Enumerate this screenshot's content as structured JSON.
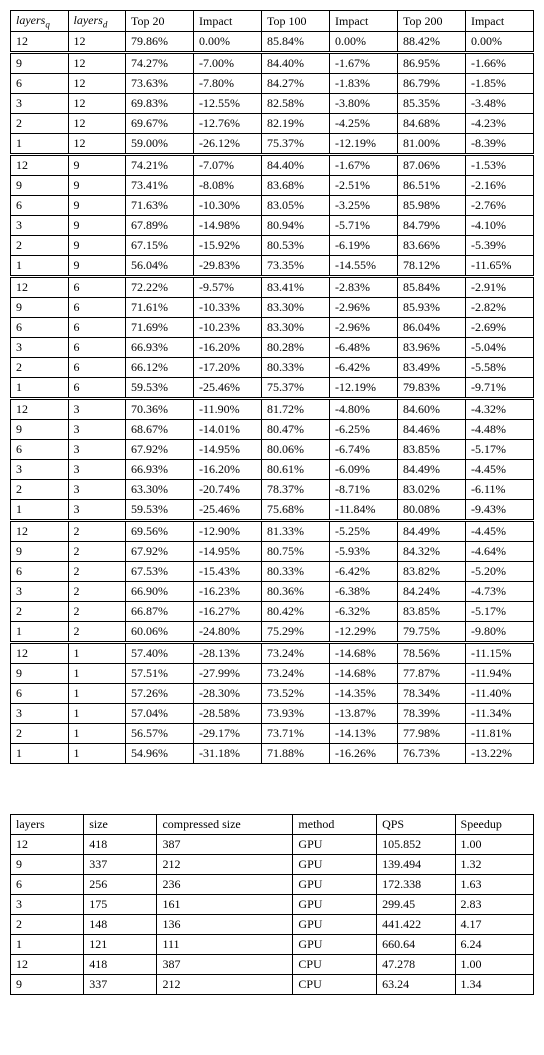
{
  "chart_data": [
    {
      "type": "table",
      "title": "",
      "columns": [
        "layers_q",
        "layers_d",
        "Top 20",
        "Impact",
        "Top 100",
        "Impact",
        "Top 200",
        "Impact"
      ],
      "groups": [
        [
          {
            "layers_q": "12",
            "layers_d": "12",
            "top20": "79.86%",
            "impact20": "0.00%",
            "top100": "85.84%",
            "impact100": "0.00%",
            "top200": "88.42%",
            "impact200": "0.00%"
          }
        ],
        [
          {
            "layers_q": "9",
            "layers_d": "12",
            "top20": "74.27%",
            "impact20": "-7.00%",
            "top100": "84.40%",
            "impact100": "-1.67%",
            "top200": "86.95%",
            "impact200": "-1.66%"
          },
          {
            "layers_q": "6",
            "layers_d": "12",
            "top20": "73.63%",
            "impact20": "-7.80%",
            "top100": "84.27%",
            "impact100": "-1.83%",
            "top200": "86.79%",
            "impact200": "-1.85%"
          },
          {
            "layers_q": "3",
            "layers_d": "12",
            "top20": "69.83%",
            "impact20": "-12.55%",
            "top100": "82.58%",
            "impact100": "-3.80%",
            "top200": "85.35%",
            "impact200": "-3.48%"
          },
          {
            "layers_q": "2",
            "layers_d": "12",
            "top20": "69.67%",
            "impact20": "-12.76%",
            "top100": "82.19%",
            "impact100": "-4.25%",
            "top200": "84.68%",
            "impact200": "-4.23%"
          },
          {
            "layers_q": "1",
            "layers_d": "12",
            "top20": "59.00%",
            "impact20": "-26.12%",
            "top100": "75.37%",
            "impact100": "-12.19%",
            "top200": "81.00%",
            "impact200": "-8.39%"
          }
        ],
        [
          {
            "layers_q": "12",
            "layers_d": "9",
            "top20": "74.21%",
            "impact20": "-7.07%",
            "top100": "84.40%",
            "impact100": "-1.67%",
            "top200": "87.06%",
            "impact200": "-1.53%"
          },
          {
            "layers_q": "9",
            "layers_d": "9",
            "top20": "73.41%",
            "impact20": "-8.08%",
            "top100": "83.68%",
            "impact100": "-2.51%",
            "top200": "86.51%",
            "impact200": "-2.16%"
          },
          {
            "layers_q": "6",
            "layers_d": "9",
            "top20": "71.63%",
            "impact20": "-10.30%",
            "top100": "83.05%",
            "impact100": "-3.25%",
            "top200": "85.98%",
            "impact200": "-2.76%"
          },
          {
            "layers_q": "3",
            "layers_d": "9",
            "top20": "67.89%",
            "impact20": "-14.98%",
            "top100": "80.94%",
            "impact100": "-5.71%",
            "top200": "84.79%",
            "impact200": "-4.10%"
          },
          {
            "layers_q": "2",
            "layers_d": "9",
            "top20": "67.15%",
            "impact20": "-15.92%",
            "top100": "80.53%",
            "impact100": "-6.19%",
            "top200": "83.66%",
            "impact200": "-5.39%"
          },
          {
            "layers_q": "1",
            "layers_d": "9",
            "top20": "56.04%",
            "impact20": "-29.83%",
            "top100": "73.35%",
            "impact100": "-14.55%",
            "top200": "78.12%",
            "impact200": "-11.65%"
          }
        ],
        [
          {
            "layers_q": "12",
            "layers_d": "6",
            "top20": "72.22%",
            "impact20": "-9.57%",
            "top100": "83.41%",
            "impact100": "-2.83%",
            "top200": "85.84%",
            "impact200": "-2.91%"
          },
          {
            "layers_q": "9",
            "layers_d": "6",
            "top20": "71.61%",
            "impact20": "-10.33%",
            "top100": "83.30%",
            "impact100": "-2.96%",
            "top200": "85.93%",
            "impact200": "-2.82%"
          },
          {
            "layers_q": "6",
            "layers_d": "6",
            "top20": "71.69%",
            "impact20": "-10.23%",
            "top100": "83.30%",
            "impact100": "-2.96%",
            "top200": "86.04%",
            "impact200": "-2.69%"
          },
          {
            "layers_q": "3",
            "layers_d": "6",
            "top20": "66.93%",
            "impact20": "-16.20%",
            "top100": "80.28%",
            "impact100": "-6.48%",
            "top200": "83.96%",
            "impact200": "-5.04%"
          },
          {
            "layers_q": "2",
            "layers_d": "6",
            "top20": "66.12%",
            "impact20": "-17.20%",
            "top100": "80.33%",
            "impact100": "-6.42%",
            "top200": "83.49%",
            "impact200": "-5.58%"
          },
          {
            "layers_q": "1",
            "layers_d": "6",
            "top20": "59.53%",
            "impact20": "-25.46%",
            "top100": "75.37%",
            "impact100": "-12.19%",
            "top200": "79.83%",
            "impact200": "-9.71%"
          }
        ],
        [
          {
            "layers_q": "12",
            "layers_d": "3",
            "top20": "70.36%",
            "impact20": "-11.90%",
            "top100": "81.72%",
            "impact100": "-4.80%",
            "top200": "84.60%",
            "impact200": "-4.32%"
          },
          {
            "layers_q": "9",
            "layers_d": "3",
            "top20": "68.67%",
            "impact20": "-14.01%",
            "top100": "80.47%",
            "impact100": "-6.25%",
            "top200": "84.46%",
            "impact200": "-4.48%"
          },
          {
            "layers_q": "6",
            "layers_d": "3",
            "top20": "67.92%",
            "impact20": "-14.95%",
            "top100": "80.06%",
            "impact100": "-6.74%",
            "top200": "83.85%",
            "impact200": "-5.17%"
          },
          {
            "layers_q": "3",
            "layers_d": "3",
            "top20": "66.93%",
            "impact20": "-16.20%",
            "top100": "80.61%",
            "impact100": "-6.09%",
            "top200": "84.49%",
            "impact200": "-4.45%"
          },
          {
            "layers_q": "2",
            "layers_d": "3",
            "top20": "63.30%",
            "impact20": "-20.74%",
            "top100": "78.37%",
            "impact100": "-8.71%",
            "top200": "83.02%",
            "impact200": "-6.11%"
          },
          {
            "layers_q": "1",
            "layers_d": "3",
            "top20": "59.53%",
            "impact20": "-25.46%",
            "top100": "75.68%",
            "impact100": "-11.84%",
            "top200": "80.08%",
            "impact200": "-9.43%"
          }
        ],
        [
          {
            "layers_q": "12",
            "layers_d": "2",
            "top20": "69.56%",
            "impact20": "-12.90%",
            "top100": "81.33%",
            "impact100": "-5.25%",
            "top200": "84.49%",
            "impact200": "-4.45%"
          },
          {
            "layers_q": "9",
            "layers_d": "2",
            "top20": "67.92%",
            "impact20": "-14.95%",
            "top100": "80.75%",
            "impact100": "-5.93%",
            "top200": "84.32%",
            "impact200": "-4.64%"
          },
          {
            "layers_q": "6",
            "layers_d": "2",
            "top20": "67.53%",
            "impact20": "-15.43%",
            "top100": "80.33%",
            "impact100": "-6.42%",
            "top200": "83.82%",
            "impact200": "-5.20%"
          },
          {
            "layers_q": "3",
            "layers_d": "2",
            "top20": "66.90%",
            "impact20": "-16.23%",
            "top100": "80.36%",
            "impact100": "-6.38%",
            "top200": "84.24%",
            "impact200": "-4.73%"
          },
          {
            "layers_q": "2",
            "layers_d": "2",
            "top20": "66.87%",
            "impact20": "-16.27%",
            "top100": "80.42%",
            "impact100": "-6.32%",
            "top200": "83.85%",
            "impact200": "-5.17%"
          },
          {
            "layers_q": "1",
            "layers_d": "2",
            "top20": "60.06%",
            "impact20": "-24.80%",
            "top100": "75.29%",
            "impact100": "-12.29%",
            "top200": "79.75%",
            "impact200": "-9.80%"
          }
        ],
        [
          {
            "layers_q": "12",
            "layers_d": "1",
            "top20": "57.40%",
            "impact20": "-28.13%",
            "top100": "73.24%",
            "impact100": "-14.68%",
            "top200": "78.56%",
            "impact200": "-11.15%"
          },
          {
            "layers_q": "9",
            "layers_d": "1",
            "top20": "57.51%",
            "impact20": "-27.99%",
            "top100": "73.24%",
            "impact100": "-14.68%",
            "top200": "77.87%",
            "impact200": "-11.94%"
          },
          {
            "layers_q": "6",
            "layers_d": "1",
            "top20": "57.26%",
            "impact20": "-28.30%",
            "top100": "73.52%",
            "impact100": "-14.35%",
            "top200": "78.34%",
            "impact200": "-11.40%"
          },
          {
            "layers_q": "3",
            "layers_d": "1",
            "top20": "57.04%",
            "impact20": "-28.58%",
            "top100": "73.93%",
            "impact100": "-13.87%",
            "top200": "78.39%",
            "impact200": "-11.34%"
          },
          {
            "layers_q": "2",
            "layers_d": "1",
            "top20": "56.57%",
            "impact20": "-29.17%",
            "top100": "73.71%",
            "impact100": "-14.13%",
            "top200": "77.98%",
            "impact200": "-11.81%"
          },
          {
            "layers_q": "1",
            "layers_d": "1",
            "top20": "54.96%",
            "impact20": "-31.18%",
            "top100": "71.88%",
            "impact100": "-16.26%",
            "top200": "76.73%",
            "impact200": "-13.22%"
          }
        ]
      ]
    },
    {
      "type": "table",
      "columns": [
        "layers",
        "size",
        "compressed size",
        "method",
        "QPS",
        "Speedup"
      ],
      "rows": [
        {
          "layers": "12",
          "size": "418",
          "csize": "387",
          "method": "GPU",
          "qps": "105.852",
          "speedup": "1.00"
        },
        {
          "layers": "9",
          "size": "337",
          "csize": "212",
          "method": "GPU",
          "qps": "139.494",
          "speedup": "1.32"
        },
        {
          "layers": "6",
          "size": "256",
          "csize": "236",
          "method": "GPU",
          "qps": "172.338",
          "speedup": "1.63"
        },
        {
          "layers": "3",
          "size": "175",
          "csize": "161",
          "method": "GPU",
          "qps": "299.45",
          "speedup": "2.83"
        },
        {
          "layers": "2",
          "size": "148",
          "csize": "136",
          "method": "GPU",
          "qps": "441.422",
          "speedup": "4.17"
        },
        {
          "layers": "1",
          "size": "121",
          "csize": "111",
          "method": "GPU",
          "qps": "660.64",
          "speedup": "6.24"
        },
        {
          "layers": "12",
          "size": "418",
          "csize": "387",
          "method": "CPU",
          "qps": "47.278",
          "speedup": "1.00"
        },
        {
          "layers": "9",
          "size": "337",
          "csize": "212",
          "method": "CPU",
          "qps": "63.24",
          "speedup": "1.34"
        }
      ]
    }
  ],
  "table1": {
    "headers": {
      "layers_q_prefix": "layers",
      "layers_q_sub": "q",
      "layers_d_prefix": "layers",
      "layers_d_sub": "d",
      "top20": "Top 20",
      "impact20": "Impact",
      "top100": "Top 100",
      "impact100": "Impact",
      "top200": "Top 200",
      "impact200": "Impact"
    }
  },
  "table2": {
    "headers": {
      "layers": "layers",
      "size": "size",
      "csize": "compressed size",
      "method": "method",
      "qps": "QPS",
      "speedup": "Speedup"
    }
  }
}
